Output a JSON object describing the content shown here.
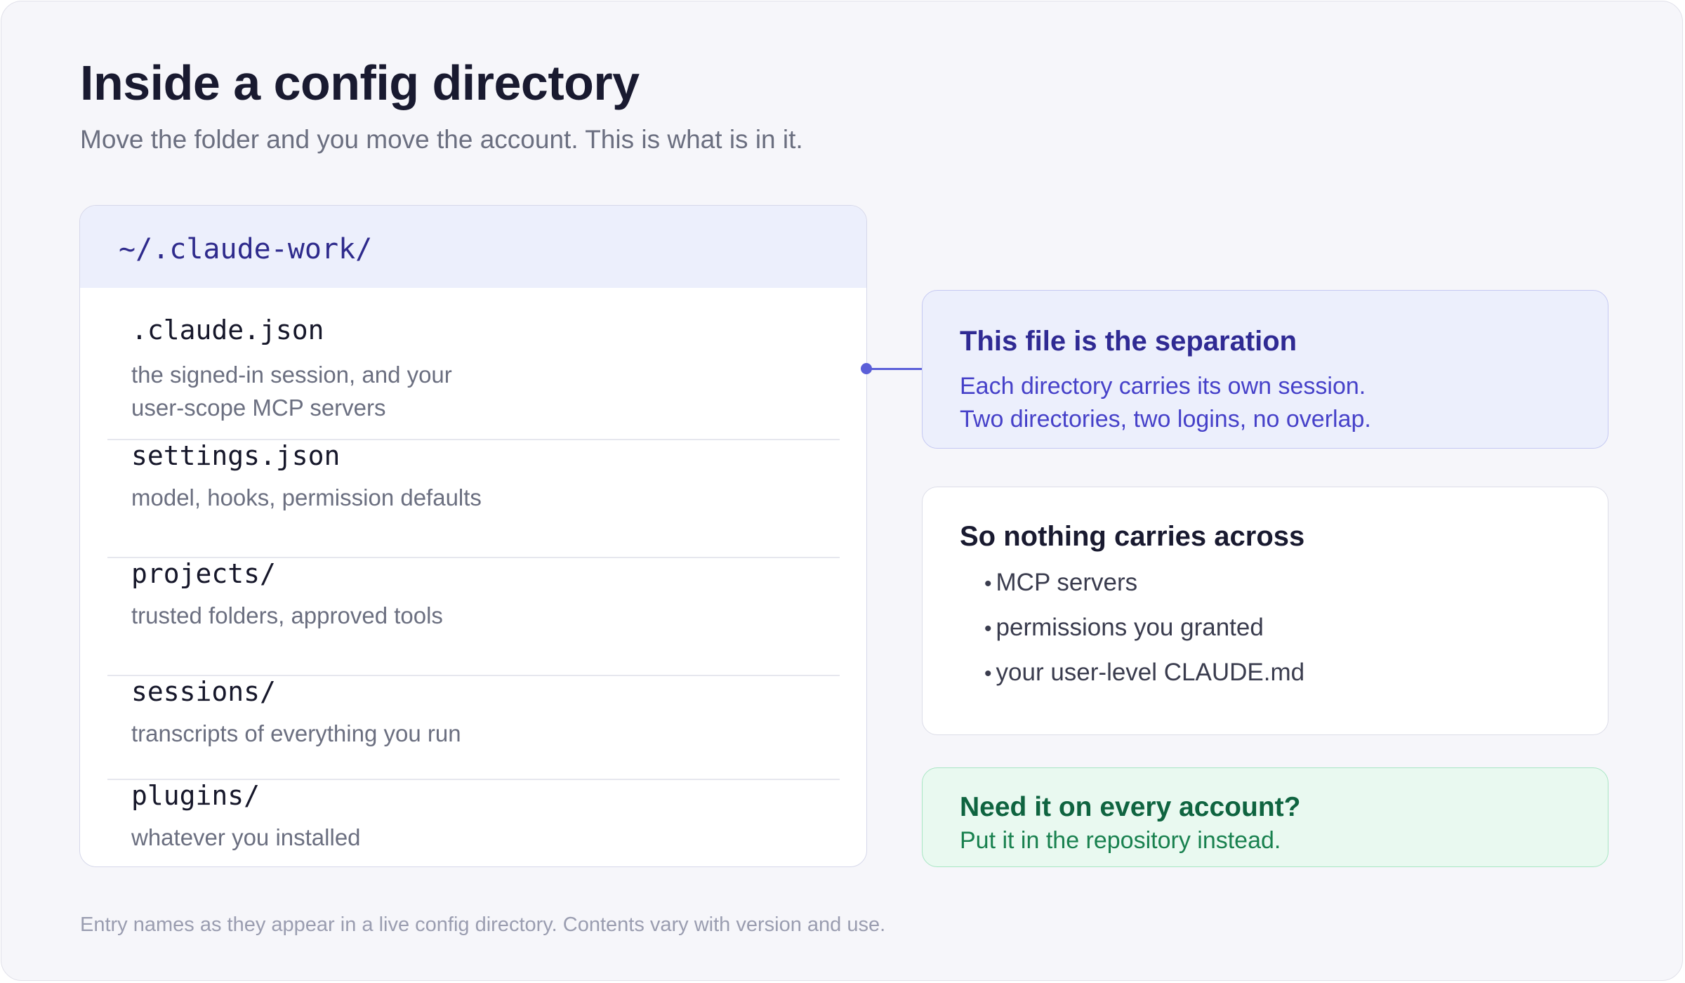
{
  "title": "Inside a config directory",
  "subtitle": "Move the folder and you move the account. This is what is in it.",
  "tree": {
    "path": "~/.claude-work/",
    "entries": [
      {
        "name": ".claude.json",
        "description": "the signed-in session, and your user-scope MCP servers"
      },
      {
        "name": "settings.json",
        "description": "model, hooks, permission defaults"
      },
      {
        "name": "projects/",
        "description": "trusted folders, approved tools"
      },
      {
        "name": "sessions/",
        "description": "transcripts of everything you run"
      },
      {
        "name": "plugins/",
        "description": "whatever you installed"
      }
    ]
  },
  "callouts": {
    "separation": {
      "title": "This file is the separation",
      "lines": [
        "Each directory carries its own session.",
        "Two directories, two logins, no overlap."
      ]
    },
    "nothing_carries": {
      "title": "So nothing carries across",
      "items": [
        "MCP servers",
        "permissions you granted",
        "your user-level CLAUDE.md"
      ]
    },
    "need_it": {
      "title": "Need it on every account?",
      "text": "Put it in the repository instead."
    }
  },
  "footnote": "Entry names as they appear in a live config directory. Contents vary with version and use.",
  "colors": {
    "background": "#f6f6fa",
    "accent": "#5b5fd8",
    "separation_fill": "#eceffc",
    "need_fill": "#e9f9f0",
    "need_text": "#0f6440"
  }
}
